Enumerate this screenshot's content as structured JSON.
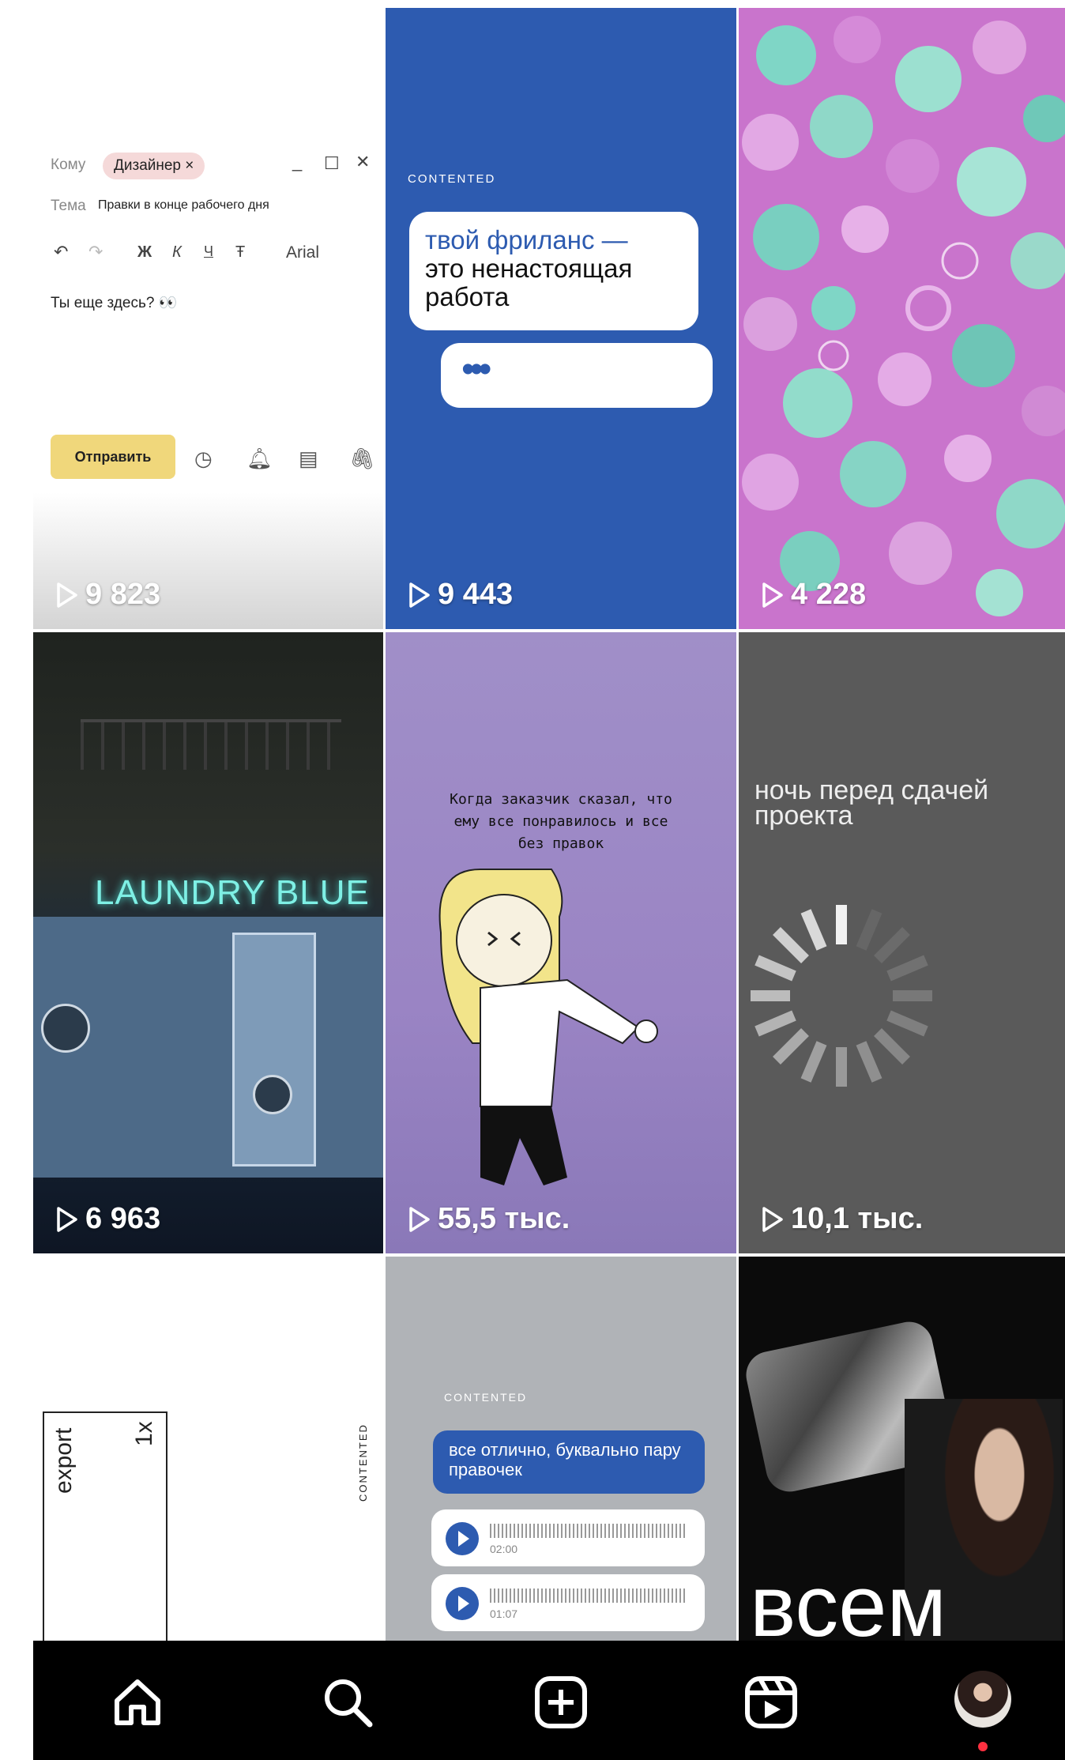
{
  "tiles": [
    {
      "views": "9 823",
      "email": {
        "to_label": "Кому",
        "recipient": "Дизайнер ×",
        "subject_label": "Тема",
        "subject": "Правки в конце рабочего дня",
        "font": "Arial",
        "body": "Ты еще здесь? 👀",
        "send_label": "Отправить"
      }
    },
    {
      "views": "9 443",
      "brand": "CONTENTED",
      "bubble_highlight": "твой фриланс —",
      "bubble_text": "это ненастоящая работа",
      "typing": "•••"
    },
    {
      "views": "4 228"
    },
    {
      "views": "6 963",
      "sign": "LAUNDRY BLUE"
    },
    {
      "views": "55,5 тыс.",
      "caption": "Когда заказчик сказал, что ему все понравилось и все без правок"
    },
    {
      "views": "10,1 тыс.",
      "caption": "ночь перед сдачей проекта"
    },
    {
      "word": "export",
      "scale": "1x",
      "brand": "CONTENTED"
    },
    {
      "brand": "CONTENTED",
      "message": "все отлично, буквально пару правочек",
      "voice": [
        "02:00",
        "01:07"
      ]
    },
    {
      "word": "всем"
    }
  ],
  "nav": {
    "items": [
      "home-icon",
      "search-icon",
      "create-icon",
      "reels-icon",
      "profile-avatar"
    ],
    "notification_color": "#ff3040"
  }
}
